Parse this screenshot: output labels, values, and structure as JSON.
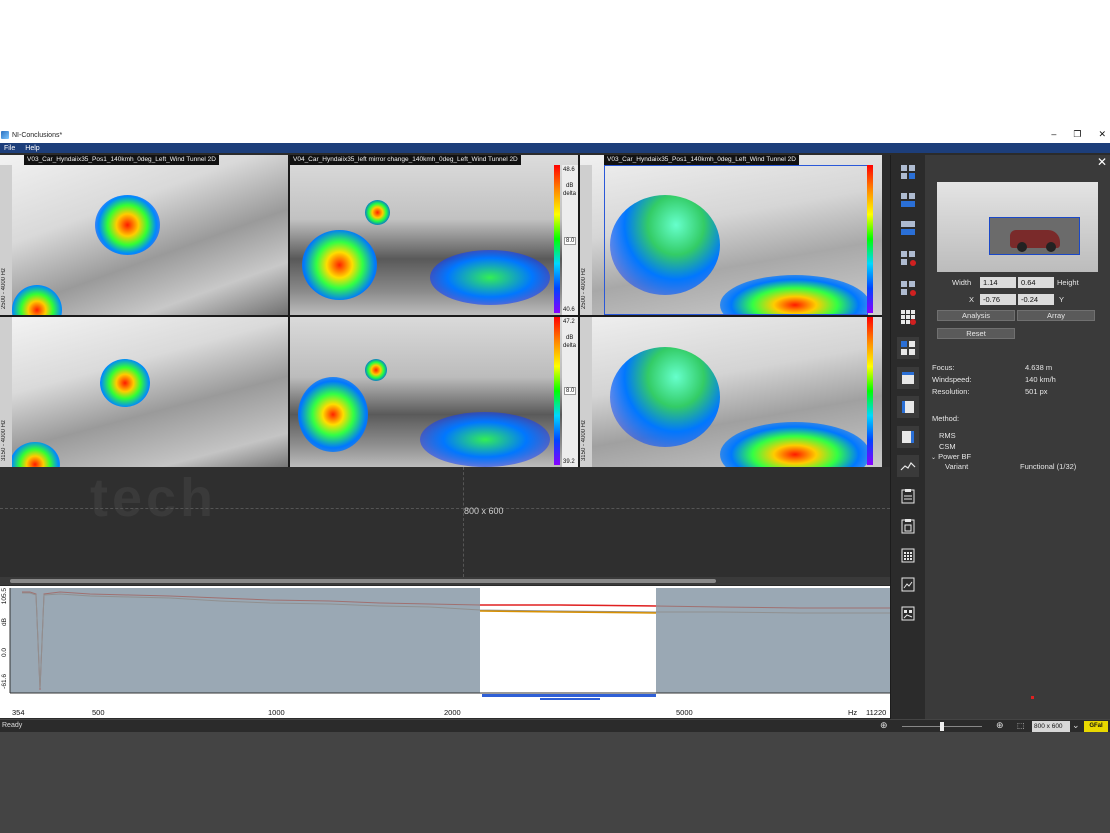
{
  "window": {
    "title": "NI-Conclusions*",
    "controls": [
      "–",
      "❐",
      "✕"
    ]
  },
  "menu": {
    "file": "File",
    "help": "Help"
  },
  "views": [
    {
      "label": "V03_Car_Hyndaiix35_Pos1_140kmh_0deg_Left_Wind Tunnel 2D",
      "freq": "2500 - 4000 Hz"
    },
    {
      "label": "V04_Car_Hyndaiix35_left mirror change_140kmh_0deg_Left_Wind Tunnel 2D",
      "scale_top": "48.6",
      "scale_unit": "dB",
      "scale_mode": "delta",
      "scale_mid": "8.0",
      "scale_bottom": "40.6"
    },
    {
      "label": "V03_Car_Hyndaiix35_Pos1_140kmh_0deg_Left_Wind Tunnel 2D",
      "freq": "2500 - 4000 Hz"
    },
    {
      "freq": "3150 - 4000 Hz"
    },
    {
      "scale_top": "47.2",
      "scale_unit": "dB",
      "scale_mode": "delta",
      "scale_mid": "8.0",
      "scale_bottom": "39.2"
    },
    {
      "freq": "3150 - 4000 Hz"
    }
  ],
  "canvas": {
    "size_label": "800 x 600",
    "watermark": "tech"
  },
  "spectrum": {
    "y_top": "105.5",
    "y_unit": "dB",
    "y_mid": "0.0",
    "y_bottom": "-61.6",
    "x_labels": [
      "354",
      "500",
      "1000",
      "2000",
      "5000",
      "Hz",
      "11220"
    ]
  },
  "panel": {
    "width_label": "Width",
    "width_value": "1.14",
    "height_value": "0.64",
    "height_label": "Height",
    "x_label": "X",
    "x_value": "-0.76",
    "y_value": "-0.24",
    "y_label": "Y",
    "analysis_button": "Analysis",
    "array_button": "Array",
    "reset_button": "Reset",
    "focus_label": "Focus:",
    "focus_value": "4.638 m",
    "windspeed_label": "Windspeed:",
    "windspeed_value": "140 km/h",
    "resolution_label": "Resolution:",
    "resolution_value": "501 px",
    "method_label": "Method:",
    "method_rms": "RMS",
    "method_csm": "CSM",
    "method_powerbf": "Power BF",
    "variant_label": "Variant",
    "variant_value": "Functional (1/32)"
  },
  "status": {
    "ready": "Ready",
    "size_select": "800 x 600"
  },
  "colors": {
    "accent": "#1d3e7a",
    "workspace": "#2b2b2b",
    "panel": "#3a3a3a"
  },
  "icons": [
    "view-layout-icon",
    "zoom-icon",
    "clipboard-icon",
    "grid-icon",
    "chart-icon"
  ]
}
